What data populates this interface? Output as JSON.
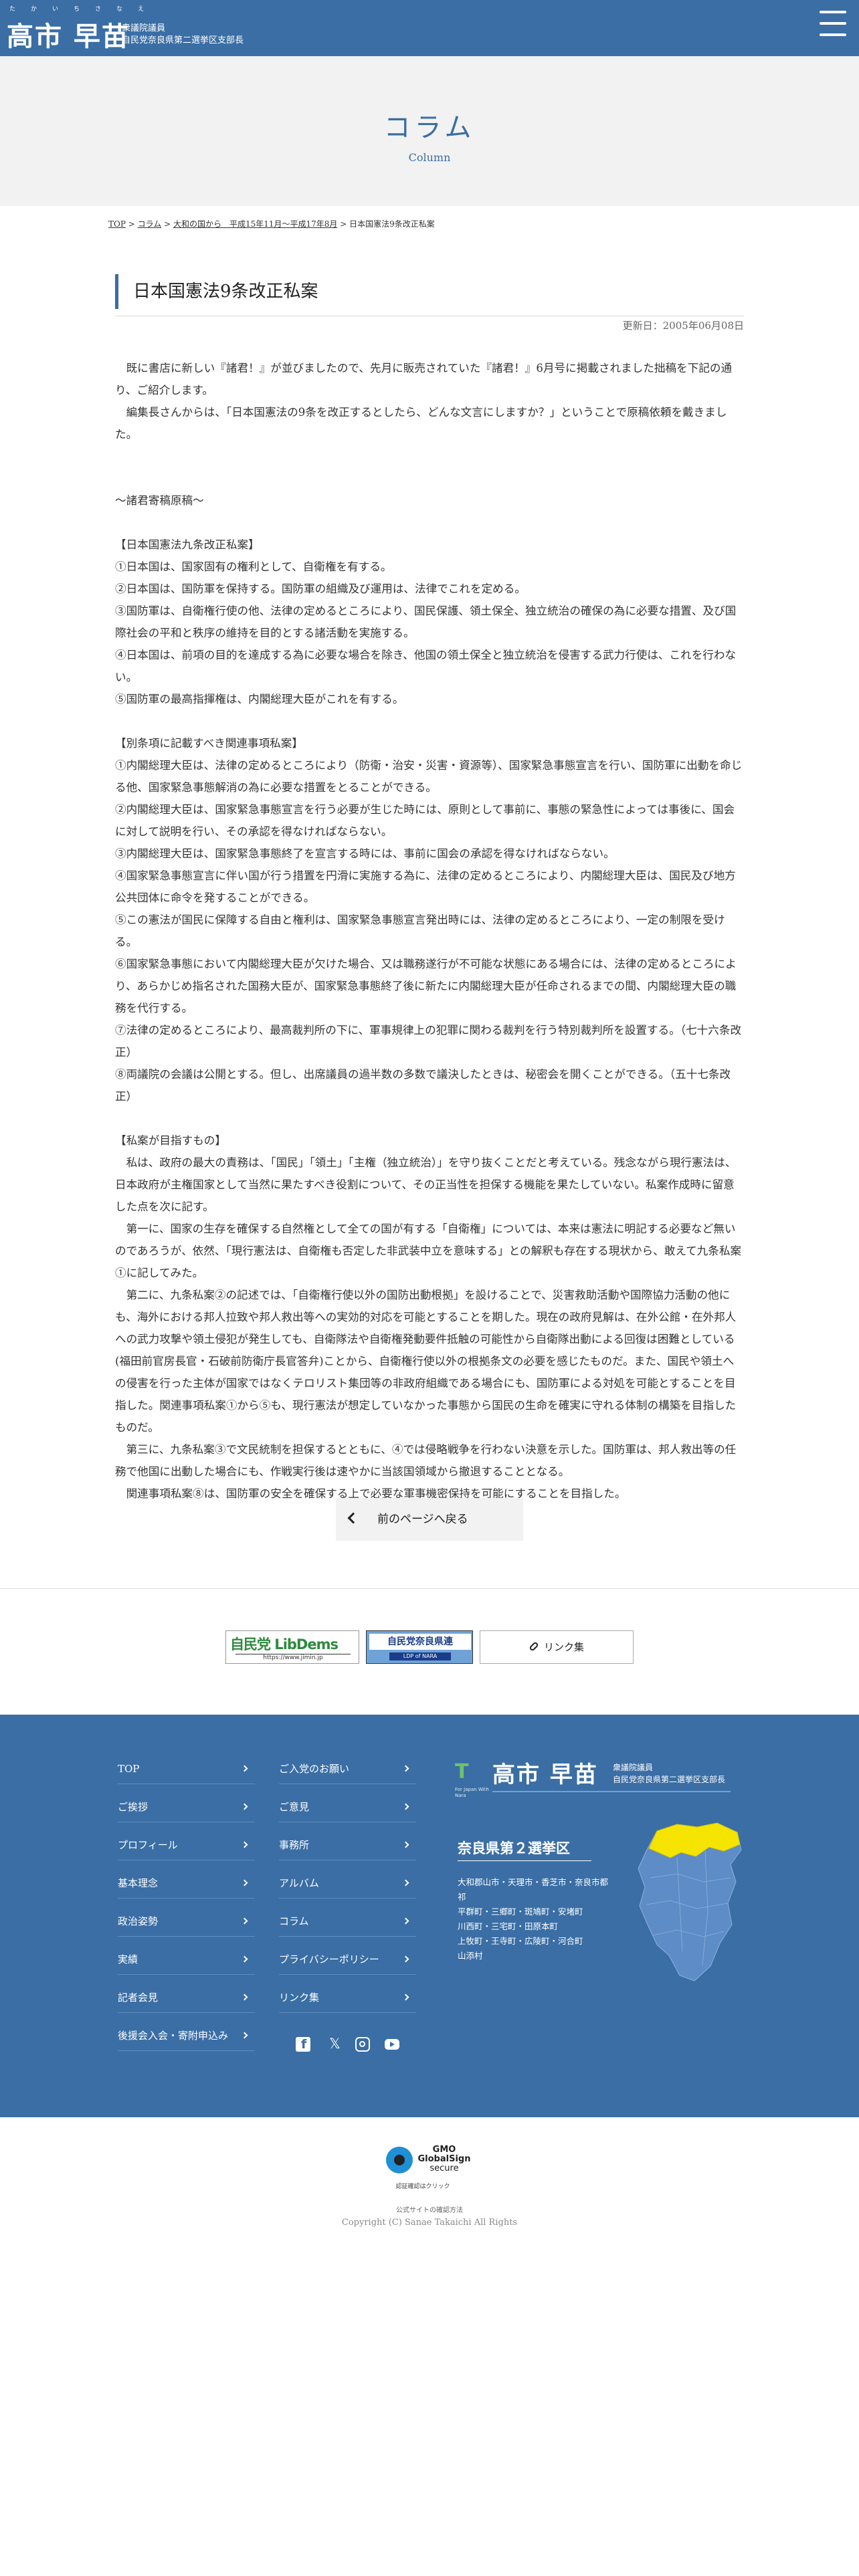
{
  "colors": {
    "brand": "#3a6ea5",
    "footer_bg": "#3a6ea5",
    "hero_bg": "#f2f2f2"
  },
  "header": {
    "logo_ruby": "たかいちさなえ",
    "logo_name": "高市 早苗",
    "logo_sub1": "衆議院議員",
    "logo_sub2": "自民党奈良県第二選挙区支部長",
    "menu_icon": "hamburger-icon"
  },
  "hero": {
    "title": "コラム",
    "subtitle": "Column"
  },
  "breadcrumb": {
    "items": [
      "TOP",
      "コラム",
      "大和の国から　平成15年11月～平成17年8月"
    ],
    "separator": " > ",
    "current": "日本国憲法9条改正私案"
  },
  "article": {
    "title": "日本国憲法9条改正私案",
    "updated": "更新日：2005年06月08日",
    "intro": [
      "既に書店に新しい『諸君！』が並びましたので、先月に販売されていた『諸君！』6月号に掲載されました拙稿を下記の通り、ご紹介します。",
      "編集長さんからは、「日本国憲法の9条を改正するとしたら、どんな文言にしますか？」ということで原稿依頼を戴きました。"
    ],
    "contribution_heading": "～諸君寄稿原稿～",
    "amendment_heading": "【日本国憲法九条改正私案】",
    "amendment_items": [
      "①日本国は、国家固有の権利として、自衛権を有する。",
      "②日本国は、国防軍を保持する。国防軍の組織及び運用は、法律でこれを定める。",
      "③国防軍は、自衛権行使の他、法律の定めるところにより、国民保護、領土保全、独立統治の確保の為に必要な措置、及び国際社会の平和と秩序の維持を目的とする諸活動を実施する。",
      "④日本国は、前項の目的を達成する為に必要な場合を除き、他国の領土保全と独立統治を侵害する武力行使は、これを行わない。",
      "⑤国防軍の最高指揮権は、内閣総理大臣がこれを有する。"
    ],
    "related_heading": "【別条項に記載すべき関連事項私案】",
    "related_items": [
      "①内閣総理大臣は、法律の定めるところにより（防衛・治安・災害・資源等）、国家緊急事態宣言を行い、国防軍に出動を命じる他、国家緊急事態解消の為に必要な措置をとることができる。",
      "②内閣総理大臣は、国家緊急事態宣言を行う必要が生じた時には、原則として事前に、事態の緊急性によっては事後に、国会に対して説明を行い、その承認を得なければならない。",
      "③内閣総理大臣は、国家緊急事態終了を宣言する時には、事前に国会の承認を得なければならない。",
      "④国家緊急事態宣言に伴い国が行う措置を円滑に実施する為に、法律の定めるところにより、内閣総理大臣は、国民及び地方公共団体に命令を発することができる。",
      "⑤この憲法が国民に保障する自由と権利は、国家緊急事態宣言発出時には、法律の定めるところにより、一定の制限を受ける。",
      "⑥国家緊急事態において内閣総理大臣が欠けた場合、又は職務遂行が不可能な状態にある場合には、法律の定めるところにより、あらかじめ指名された国務大臣が、国家緊急事態終了後に新たに内閣総理大臣が任命されるまでの間、内閣総理大臣の職務を代行する。",
      "⑦法律の定めるところにより、最高裁判所の下に、軍事規律上の犯罪に関わる裁判を行う特別裁判所を設置する。（七十六条改正）",
      "⑧両議院の会議は公開とする。但し、出席議員の過半数の多数で議決したときは、秘密会を開くことができる。（五十七条改正）"
    ],
    "aim_heading": "【私案が目指すもの】",
    "aim_paragraphs": [
      "私は、政府の最大の責務は、「国民」「領土」「主権（独立統治）」を守り抜くことだと考えている。残念ながら現行憲法は、日本政府が主権国家として当然に果たすべき役割について、その正当性を担保する機能を果たしていない。私案作成時に留意した点を次に記す。",
      "第一に、国家の生存を確保する自然権として全ての国が有する「自衛権」については、本来は憲法に明記する必要など無いのであろうが、依然、「現行憲法は、自衛権も否定した非武装中立を意味する」との解釈も存在する現状から、敢えて九条私案①に記してみた。",
      "第二に、九条私案②の記述では、「自衛権行使以外の国防出動根拠」を設けることで、災害救助活動や国際協力活動の他にも、海外における邦人拉致や邦人救出等への実効的対応を可能とすることを期した。現在の政府見解は、在外公館・在外邦人への武力攻撃や領土侵犯が発生しても、自衛隊法や自衛権発動要件抵触の可能性から自衛隊出動による回復は困難としている(福田前官房長官・石破前防衛庁長官答弁)ことから、自衛権行使以外の根拠条文の必要を感じたものだ。また、国民や領土への侵害を行った主体が国家ではなくテロリスト集団等の非政府組織である場合にも、国防軍による対処を可能とすることを目指した。関連事項私案①から⑤も、現行憲法が想定していなかった事態から国民の生命を確実に守れる体制の構築を目指したものだ。",
      "第三に、九条私案③で文民統制を担保するとともに、④では侵略戦争を行わない決意を示した。国防軍は、邦人救出等の任務で他国に出動した場合にも、作戦実行後は速やかに当該国領域から撤退することとなる。",
      "関連事項私案⑧は、国防軍の安全を確保する上で必要な軍事機密保持を可能にすることを目指した。"
    ]
  },
  "back_button": {
    "label": "前のページへ戻る",
    "icon": "chevron-left-icon"
  },
  "banners": {
    "jimin_logo_text": "自民党 LibDems",
    "jimin_url": "https://www.jimin.jp",
    "nara_text": "自民党奈良県連",
    "nara_sub": "LDP of NARA",
    "links_label": "リンク集",
    "links_icon": "link-icon"
  },
  "footer": {
    "nav_col1": [
      "TOP",
      "ご挨拶",
      "プロフィール",
      "基本理念",
      "政治姿勢",
      "実績",
      "記者会見",
      "後援会入会・寄附申込み"
    ],
    "nav_col2": [
      "ご入党のお願い",
      "ご意見",
      "事務所",
      "アルバム",
      "コラム",
      "プライバシーポリシー",
      "リンク集"
    ],
    "social_icons": [
      "facebook-icon",
      "x-icon",
      "instagram-icon",
      "youtube-icon"
    ],
    "logo_mark": "T",
    "logo_tagline": "For Japan With Nara",
    "logo_name": "高市 早苗",
    "logo_sub1": "衆議院議員",
    "logo_sub2": "自民党奈良県第二選挙区支部長",
    "district_title": "奈良県第２選挙区",
    "district_lines": [
      "大和郡山市・天理市・香芝市・奈良市都祁",
      "平群町・三郷町・斑鳩町・安堵町",
      "川西町・三宅町・田原本町",
      "上牧町・王寺町・広陵町・河合町",
      "山添村"
    ],
    "map_highlight_color": "#f5e400",
    "map_base_color": "#5e8cc6"
  },
  "bottom": {
    "gmo_line1": "GMO",
    "gmo_line2": "GlobalSign",
    "gmo_line3": "secure",
    "gmo_badge": "認証確認はクリック",
    "official_note": "公式サイトの確認方法",
    "copyright": "Copyright (C) Sanae Takaichi All Rights"
  }
}
